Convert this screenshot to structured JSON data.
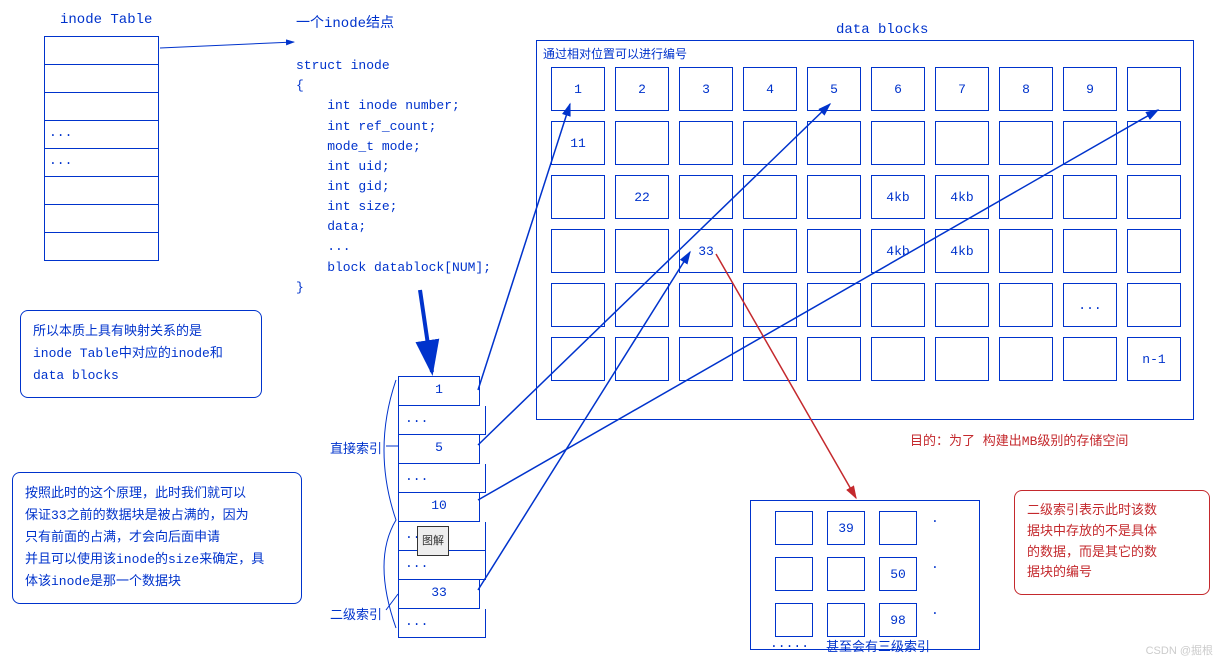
{
  "inode_table_title": "inode Table",
  "inode_table_rows": [
    "",
    "",
    "",
    "...",
    "...",
    "",
    "",
    ""
  ],
  "struct_title": "一个inode结点",
  "struct_lines": [
    "struct inode",
    "{",
    "    int inode number;",
    "    int ref_count;",
    "    mode_t mode;",
    "    int uid;",
    "    int gid;",
    "    int size;",
    "    data;",
    "    ...",
    "    block datablock[NUM];",
    "}"
  ],
  "data_blocks_title": "data blocks",
  "grid_header": "通过相对位置可以进行编号",
  "grid_cells": {
    "r0": [
      "1",
      "2",
      "3",
      "4",
      "5",
      "6",
      "7",
      "8",
      "9",
      ""
    ],
    "r1": [
      "11",
      "",
      "",
      "",
      "",
      "",
      "",
      "",
      "",
      ""
    ],
    "r2": [
      "",
      "22",
      "",
      "",
      "",
      "4kb",
      "4kb",
      "",
      "",
      ""
    ],
    "r3": [
      "",
      "",
      "33",
      "",
      "",
      "4kb",
      "4kb",
      "",
      "",
      ""
    ],
    "r4": [
      "",
      "",
      "",
      "",
      "",
      "",
      "",
      "",
      "...",
      ""
    ],
    "r5": [
      "",
      "",
      "",
      "",
      "",
      "",
      "",
      "",
      "",
      "n-1"
    ]
  },
  "note1_lines": [
    "所以本质上具有映射关系的是",
    "inode Table中对应的inode和",
    "data blocks"
  ],
  "note2_lines": [
    "按照此时的这个原理，此时我们就可以",
    "保证33之前的数据块是被占满的，因为",
    "只有前面的占满，才会向后面申请",
    "并且可以使用该inode的size来确定，具",
    "体该inode是那一个数据块"
  ],
  "datablock_rows": [
    "1",
    "...",
    "5",
    "...",
    "10",
    "...",
    "...",
    "33",
    "..."
  ],
  "label_direct": "直接索引",
  "label_second": "二级索引",
  "tag_label": "图解",
  "red_goal": "目的：为了 构建出MB级别的存储空间",
  "sub_grid": {
    "r0": [
      "",
      "39",
      ""
    ],
    "r1": [
      "",
      "",
      "50"
    ],
    "r2": [
      "",
      "",
      "98"
    ]
  },
  "sub_grid_dots": [
    ".",
    ".",
    "."
  ],
  "sub_grid_bottom": ".....",
  "sub_grid_label": "甚至会有三级索引",
  "note_red_lines": [
    "二级索引表示此时该数",
    "据块中存放的不是具体",
    "的数据，而是其它的数",
    "据块的编号"
  ],
  "watermark": "CSDN @掘根"
}
